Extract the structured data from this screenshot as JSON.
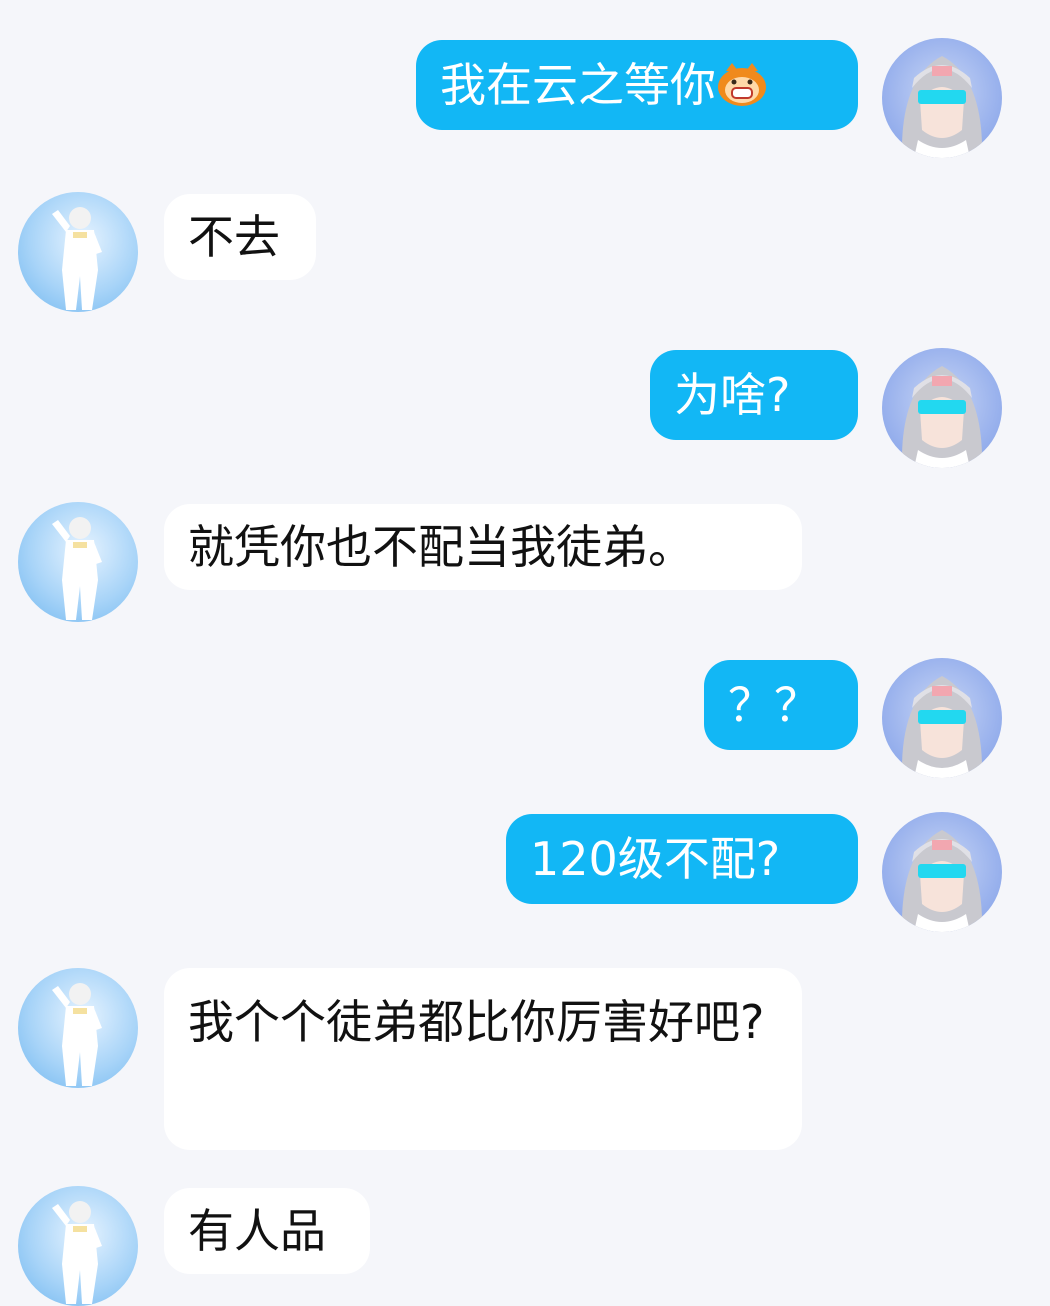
{
  "colors": {
    "background": "#f5f6fa",
    "outgoing_bubble": "#12b7f5",
    "incoming_bubble": "#ffffff",
    "outgoing_text": "#ffffff",
    "incoming_text": "#111111"
  },
  "messages": [
    {
      "sender": "me",
      "text": "我在云之等你",
      "emoji": "monkey-emoji-icon"
    },
    {
      "sender": "friend",
      "text": "不去"
    },
    {
      "sender": "me",
      "text": "为啥?"
    },
    {
      "sender": "friend",
      "text": "就凭你也不配当我徒弟。"
    },
    {
      "sender": "me",
      "text": "？？"
    },
    {
      "sender": "me",
      "text": "120级不配?"
    },
    {
      "sender": "friend",
      "text": "我个个徒弟都比你厉害好吧?"
    },
    {
      "sender": "friend",
      "text": "有人品"
    }
  ],
  "avatars": {
    "me": "anime-girl-avatar-icon",
    "friend": "white-suit-character-avatar-icon"
  }
}
